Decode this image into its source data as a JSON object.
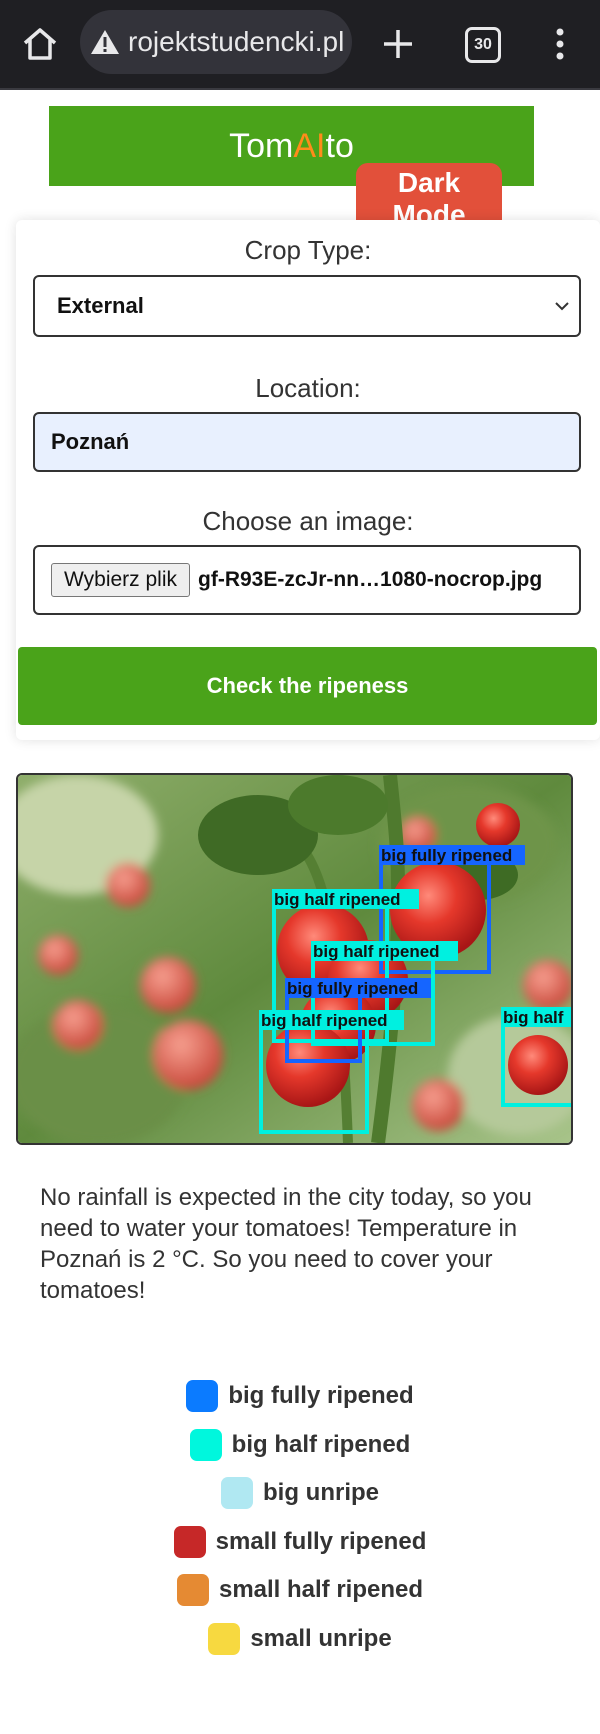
{
  "browser": {
    "url": "rojektstudencki.pl",
    "tab_count": "30"
  },
  "header": {
    "title_pre": "Tom",
    "title_ai": "AI",
    "title_post": "to",
    "dark_mode_line1": "Dark",
    "dark_mode_line2": "Mode"
  },
  "form": {
    "crop_label": "Crop Type:",
    "crop_value": "External",
    "location_label": "Location:",
    "location_value": "Poznań",
    "image_label": "Choose an image:",
    "file_button": "Wybierz plik",
    "file_name": "gf-R93E-zcJr-nn…1080-nocrop.jpg",
    "submit": "Check the ripeness"
  },
  "detections": [
    {
      "label": "big fully ripened",
      "class": "big-fully-ripened"
    },
    {
      "label": "big half ripened",
      "class": "big-half-ripened"
    },
    {
      "label": "big half ripened",
      "class": "big-half-ripened"
    },
    {
      "label": "big fully ripened",
      "class": "big-fully-ripened"
    },
    {
      "label": "big half ripened",
      "class": "big-half-ripened"
    },
    {
      "label": "big half",
      "class": "big-half-ripened"
    }
  ],
  "message": "No rainfall is expected in the city today, so you need to water your tomatoes! Temperature in Poznań is 2 °C. So you need to cover your tomatoes!",
  "legend": [
    {
      "label": "big fully ripened",
      "color": "#0b7bff"
    },
    {
      "label": "big half ripened",
      "color": "#00f7dd"
    },
    {
      "label": "big unripe",
      "color": "#b0e8f2"
    },
    {
      "label": "small fully ripened",
      "color": "#c62828"
    },
    {
      "label": "small half ripened",
      "color": "#e58a33"
    },
    {
      "label": "small unripe",
      "color": "#f7d940"
    }
  ],
  "colors": {
    "brand_green": "#4aa31a",
    "accent_orange": "#ff8c1a",
    "dark_mode_red": "#e2503a",
    "box_fully": "#1565ff",
    "box_half": "#00f0e0"
  }
}
